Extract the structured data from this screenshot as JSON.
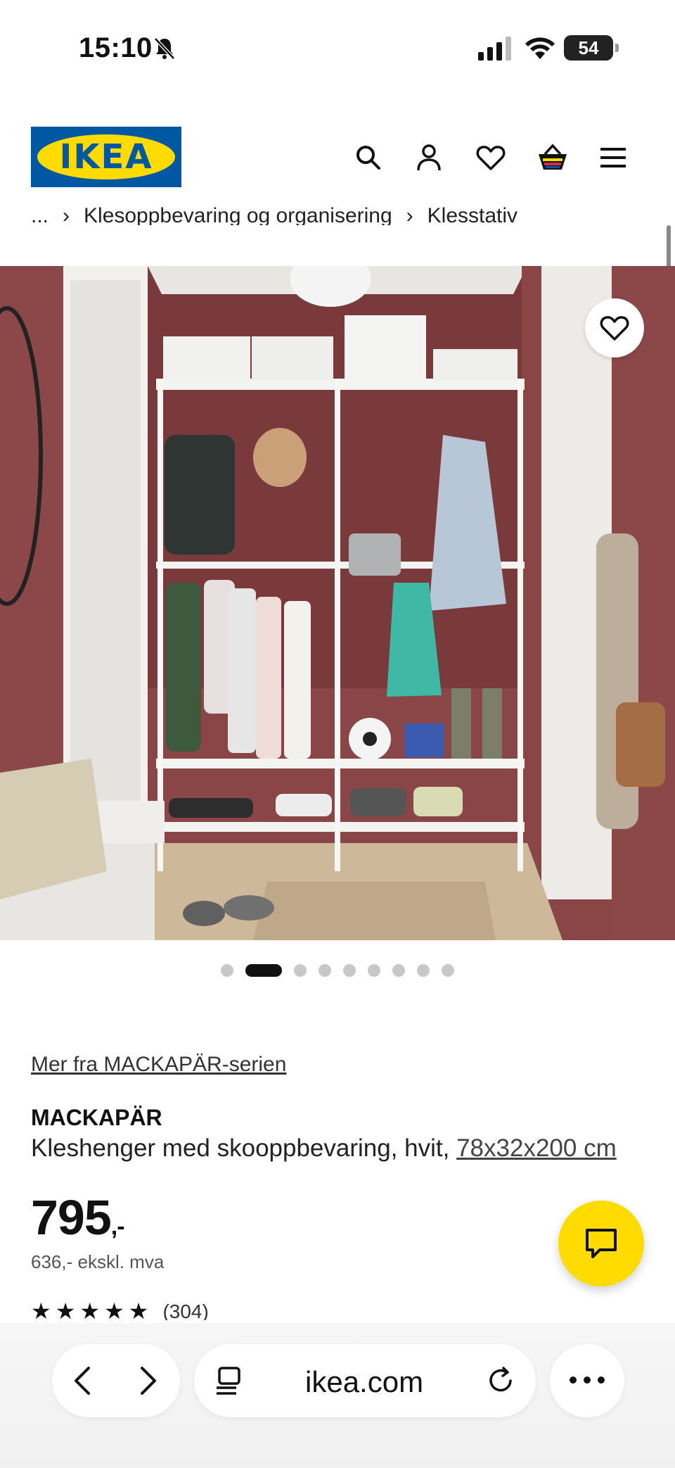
{
  "status_bar": {
    "time": "15:10",
    "battery": "54"
  },
  "header": {
    "logo_text": "IKEA",
    "icons": [
      "search-icon",
      "account-icon",
      "favourites-icon",
      "cart-icon",
      "menu-icon"
    ],
    "breadcrumb": [
      "...",
      "Klesoppbevaring og organisering",
      "Klesstativ"
    ]
  },
  "gallery": {
    "image_count": 9,
    "active_index": 1
  },
  "product": {
    "series_link": "Mer fra MACKAPÄR-serien",
    "name": "MACKAPÄR",
    "description": "Kleshenger med skooppbevaring, hvit, ",
    "dimensions": "78x32x200 cm",
    "price": "795",
    "price_suffix": ",-",
    "price_excl_vat": "636,- ekskl. mva",
    "rating": {
      "stars": 5,
      "count": "(304)"
    }
  },
  "browser": {
    "url": "ikea.com"
  },
  "colors": {
    "ikea_blue": "#0058a3",
    "ikea_yellow": "#ffdb00",
    "wall": "#8c4545"
  }
}
